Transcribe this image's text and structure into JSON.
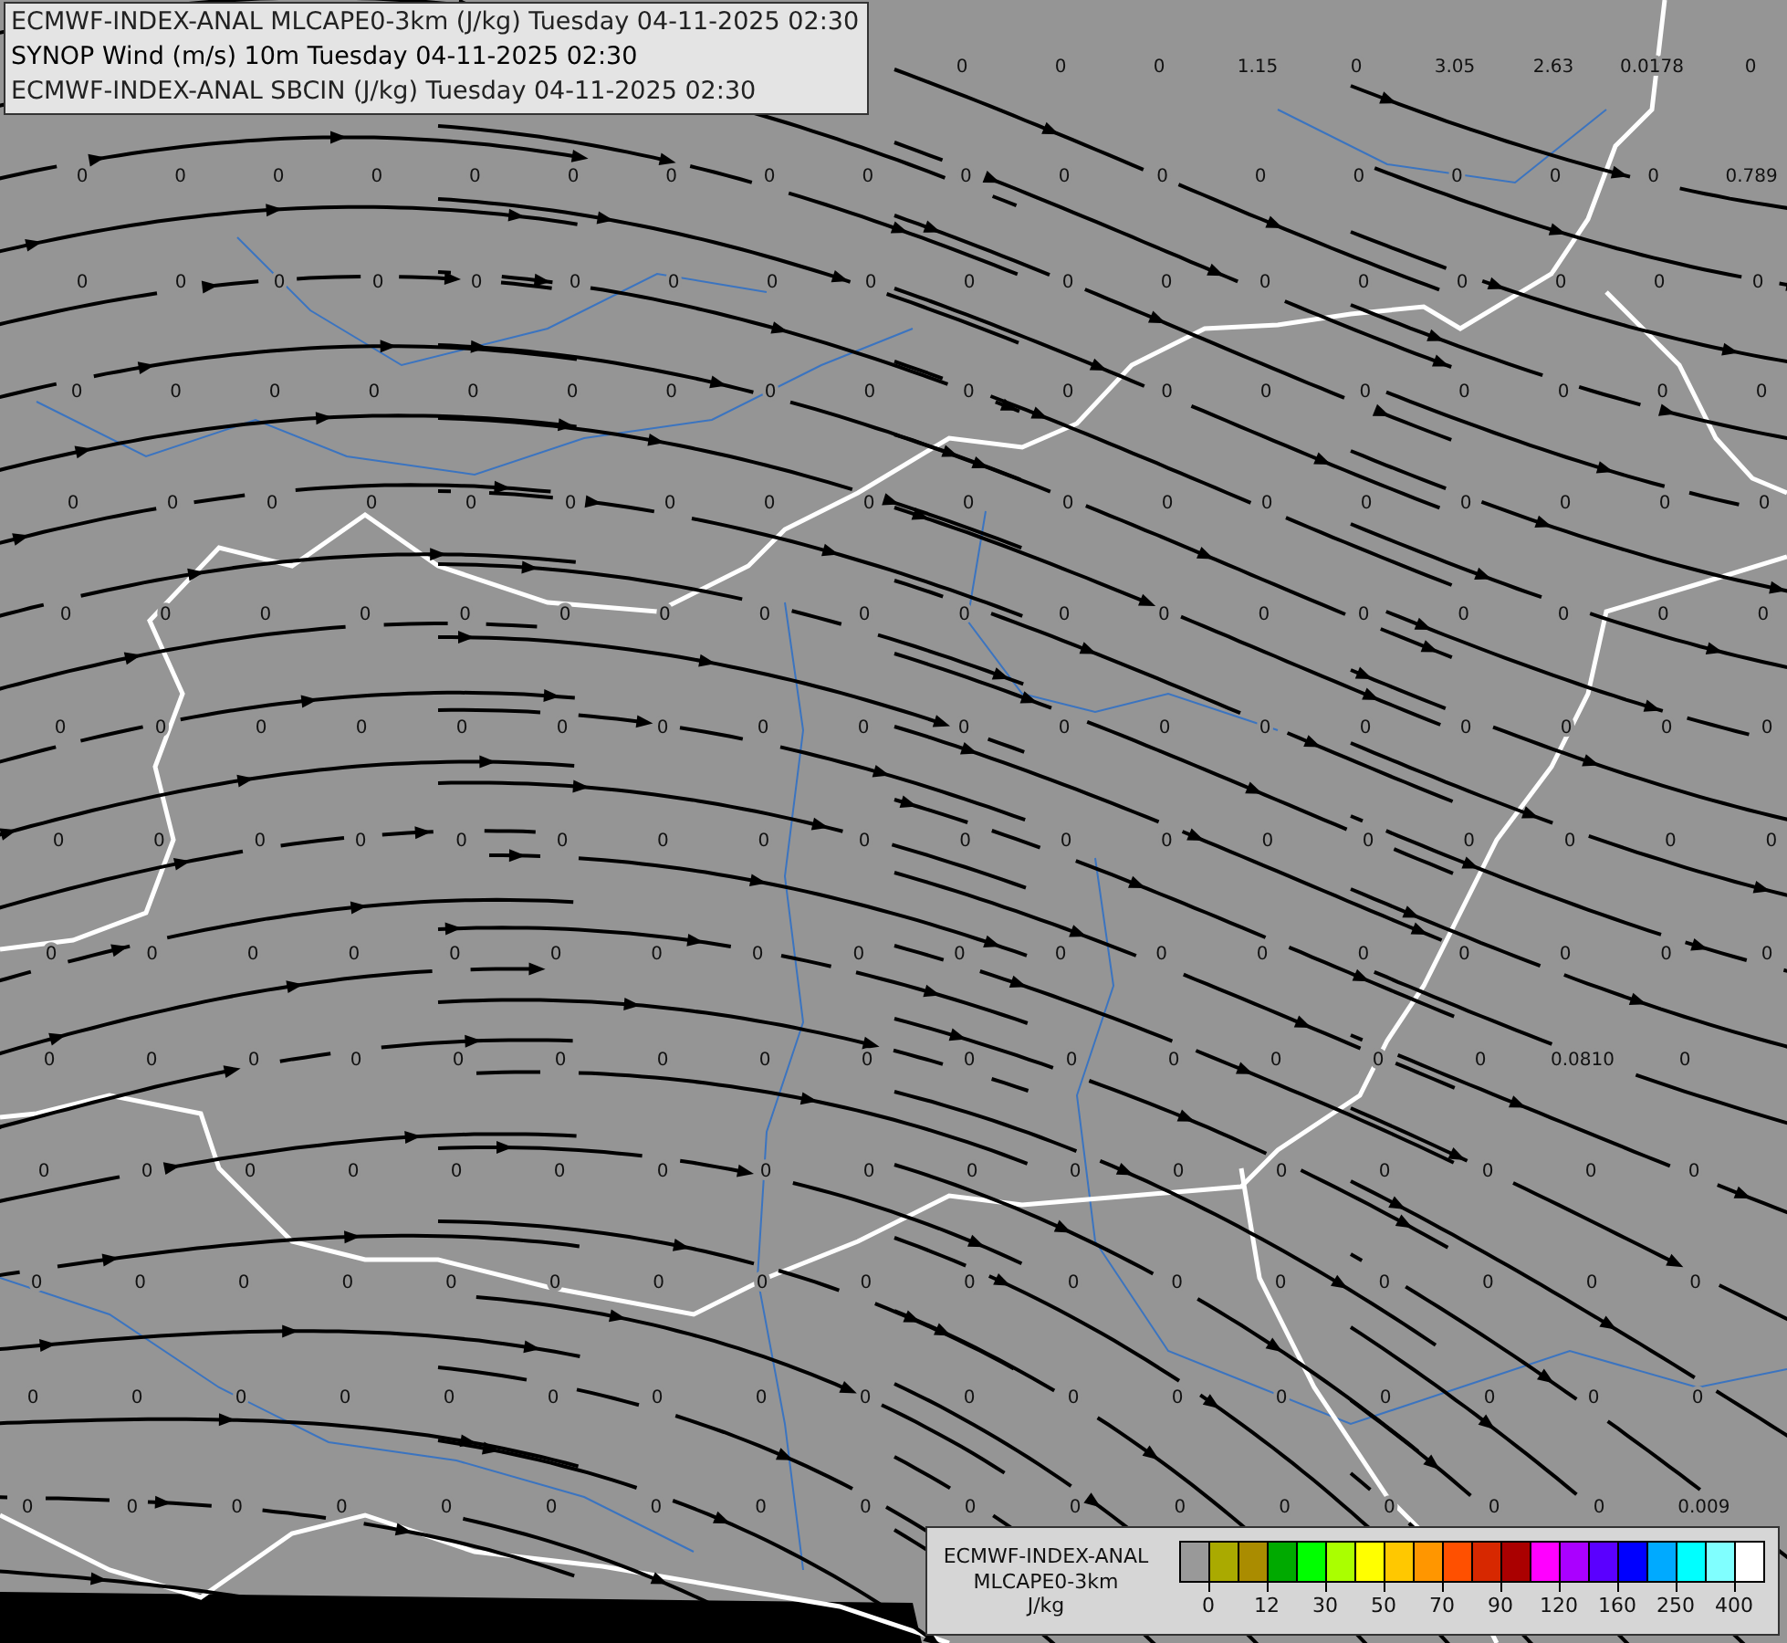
{
  "header": {
    "lines": [
      "ECMWF-INDEX-ANAL MLCAPE0-3km (J/kg) Tuesday 04-11-2025 02:30",
      "SYNOP Wind (m/s) 10m Tuesday 04-11-2025 02:30",
      "ECMWF-INDEX-ANAL SBCIN (J/kg) Tuesday 04-11-2025 02:30"
    ]
  },
  "value_grid": {
    "rows": [
      [
        null,
        null,
        null,
        null,
        null,
        null,
        null,
        null,
        null,
        "0",
        "0",
        "0",
        "1.15",
        "0",
        "3.05",
        "2.63",
        "0.0178",
        "0"
      ],
      [
        "0",
        "0",
        "0",
        "0",
        "0",
        "0",
        "0",
        "0",
        "0",
        "0",
        "0",
        "0",
        "0",
        "0",
        "0",
        "0",
        "0",
        "0.789"
      ],
      [
        "0",
        "0",
        "0",
        "0",
        "0",
        "0",
        "0",
        "0",
        "0",
        "0",
        "0",
        "0",
        "0",
        "0",
        "0",
        "0",
        "0",
        "0"
      ],
      [
        "0",
        "0",
        "0",
        "0",
        "0",
        "0",
        "0",
        "0",
        "0",
        "0",
        "0",
        "0",
        "0",
        "0",
        "0",
        "0",
        "0",
        "0"
      ],
      [
        "0",
        "0",
        "0",
        "0",
        "0",
        "0",
        "0",
        "0",
        "0",
        "0",
        "0",
        "0",
        "0",
        "0",
        "0",
        "0",
        "0",
        "0"
      ],
      [
        "0",
        "0",
        "0",
        "0",
        "0",
        "0",
        "0",
        "0",
        "0",
        "0",
        "0",
        "0",
        "0",
        "0",
        "0",
        "0",
        "0",
        "0"
      ],
      [
        "0",
        "0",
        "0",
        "0",
        "0",
        "0",
        "0",
        "0",
        "0",
        "0",
        "0",
        "0",
        "0",
        "0",
        "0",
        "0",
        "0",
        "0"
      ],
      [
        "0",
        "0",
        "0",
        "0",
        "0",
        "0",
        "0",
        "0",
        "0",
        "0",
        "0",
        "0",
        "0",
        "0",
        "0",
        "0",
        "0",
        "0"
      ],
      [
        "0",
        "0",
        "0",
        "0",
        "0",
        "0",
        "0",
        "0",
        "0",
        "0",
        "0",
        "0",
        "0",
        "0",
        "0",
        "0",
        "0",
        "0"
      ],
      [
        "0",
        "0",
        "0",
        "0",
        "0",
        "0",
        "0",
        "0",
        "0",
        "0",
        "0",
        "0",
        "0",
        "0",
        "0",
        "0.0810",
        "0"
      ],
      [
        "0",
        "0",
        "0",
        "0",
        "0",
        "0",
        "0",
        "0",
        "0",
        "0",
        "0",
        "0",
        "0",
        "0",
        "0",
        "0",
        "0"
      ],
      [
        "0",
        "0",
        "0",
        "0",
        "0",
        "0",
        "0",
        "0",
        "0",
        "0",
        "0",
        "0",
        "0",
        "0",
        "0",
        "0",
        "0"
      ],
      [
        "0",
        "0",
        "0",
        "0",
        "0",
        "0",
        "0",
        "0",
        "0",
        "0",
        "0",
        "0",
        "0",
        "0",
        "0",
        "0",
        "0"
      ],
      [
        "0",
        "0",
        "0",
        "0",
        "0",
        "0",
        "0",
        "0",
        "0",
        "0",
        "0",
        "0",
        "0",
        "0",
        "0",
        "0",
        "0.009"
      ]
    ]
  },
  "legend": {
    "title_lines": [
      "ECMWF-INDEX-ANAL",
      "MLCAPE0-3km",
      "J/kg"
    ],
    "swatches": [
      {
        "color": "#999999"
      },
      {
        "color": "#aaaa00"
      },
      {
        "color": "#aa8c00"
      },
      {
        "color": "#00aa00"
      },
      {
        "color": "#00ff00"
      },
      {
        "color": "#aaff00"
      },
      {
        "color": "#ffff00"
      },
      {
        "color": "#ffc800"
      },
      {
        "color": "#ff9600"
      },
      {
        "color": "#ff5000"
      },
      {
        "color": "#d72800"
      },
      {
        "color": "#aa0000"
      },
      {
        "color": "#ff00ff"
      },
      {
        "color": "#aa00ff"
      },
      {
        "color": "#5a00ff"
      },
      {
        "color": "#0000ff"
      },
      {
        "color": "#00aaff"
      },
      {
        "color": "#00ffff"
      },
      {
        "color": "#80ffff"
      },
      {
        "color": "#ffffff"
      }
    ],
    "ticks": [
      "0",
      "12",
      "30",
      "50",
      "70",
      "90",
      "120",
      "160",
      "250",
      "400"
    ]
  }
}
